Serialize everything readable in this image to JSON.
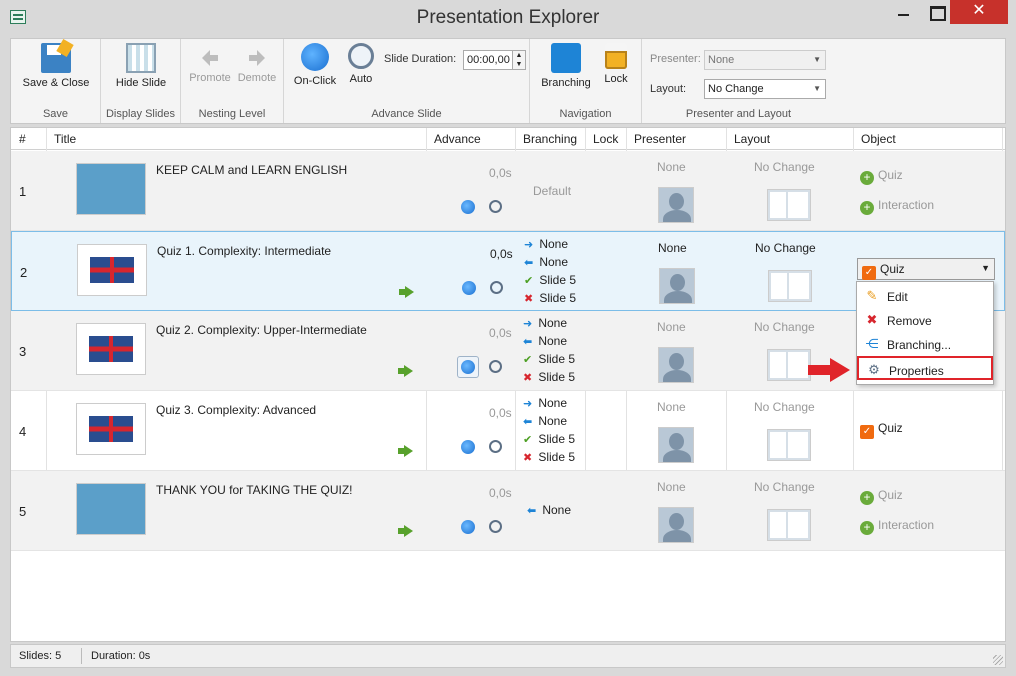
{
  "window": {
    "title": "Presentation Explorer"
  },
  "ribbon": {
    "save": {
      "button": "Save & Close",
      "group": "Save"
    },
    "display": {
      "button": "Hide Slide",
      "group": "Display Slides"
    },
    "nesting": {
      "promote": "Promote",
      "demote": "Demote",
      "group": "Nesting Level"
    },
    "advance": {
      "onclick": "On-Click",
      "auto": "Auto",
      "duration_label": "Slide Duration:",
      "duration_value": "00:00,00",
      "group": "Advance Slide"
    },
    "navigation": {
      "branching": "Branching",
      "lock": "Lock",
      "group": "Navigation"
    },
    "presenter_layout": {
      "presenter_label": "Presenter:",
      "presenter_value": "None",
      "layout_label": "Layout:",
      "layout_value": "No Change",
      "group": "Presenter and Layout"
    }
  },
  "columns": {
    "num": "#",
    "title": "Title",
    "advance": "Advance",
    "branching": "Branching",
    "lock": "Lock",
    "presenter": "Presenter",
    "layout": "Layout",
    "object": "Object"
  },
  "slides": [
    {
      "num": "1",
      "title": "KEEP CALM and LEARN ENGLISH",
      "advance_time": "0,0s",
      "branching_default": "Default",
      "presenter": "None",
      "layout": "No Change",
      "objects": [
        "Quiz",
        "Interaction"
      ]
    },
    {
      "num": "2",
      "title": "Quiz 1. Complexity: Intermediate",
      "advance_time": "0,0s",
      "branching": [
        "None",
        "None",
        "Slide 5",
        "Slide 5"
      ],
      "presenter": "None",
      "layout": "No Change",
      "object_selected": "Quiz"
    },
    {
      "num": "3",
      "title": "Quiz 2. Complexity: Upper-Intermediate",
      "advance_time": "0,0s",
      "branching": [
        "None",
        "None",
        "Slide 5",
        "Slide 5"
      ],
      "presenter": "None",
      "layout": "No Change"
    },
    {
      "num": "4",
      "title": "Quiz 3. Complexity: Advanced",
      "advance_time": "0,0s",
      "branching": [
        "None",
        "None",
        "Slide 5",
        "Slide 5"
      ],
      "presenter": "None",
      "layout": "No Change",
      "objects": [
        "Quiz"
      ]
    },
    {
      "num": "5",
      "title": "THANK YOU for TAKING THE QUIZ!",
      "advance_time": "0,0s",
      "branching": [
        "None"
      ],
      "presenter": "None",
      "layout": "No Change",
      "objects": [
        "Quiz",
        "Interaction"
      ]
    }
  ],
  "context_menu": {
    "items": [
      "Edit",
      "Remove",
      "Branching...",
      "Properties"
    ]
  },
  "status": {
    "slides": "Slides: 5",
    "duration": "Duration:  0s"
  },
  "colors": {
    "selected_row": "#e9f4fb",
    "accent": "#1e84d6",
    "highlight": "#e0242a"
  }
}
